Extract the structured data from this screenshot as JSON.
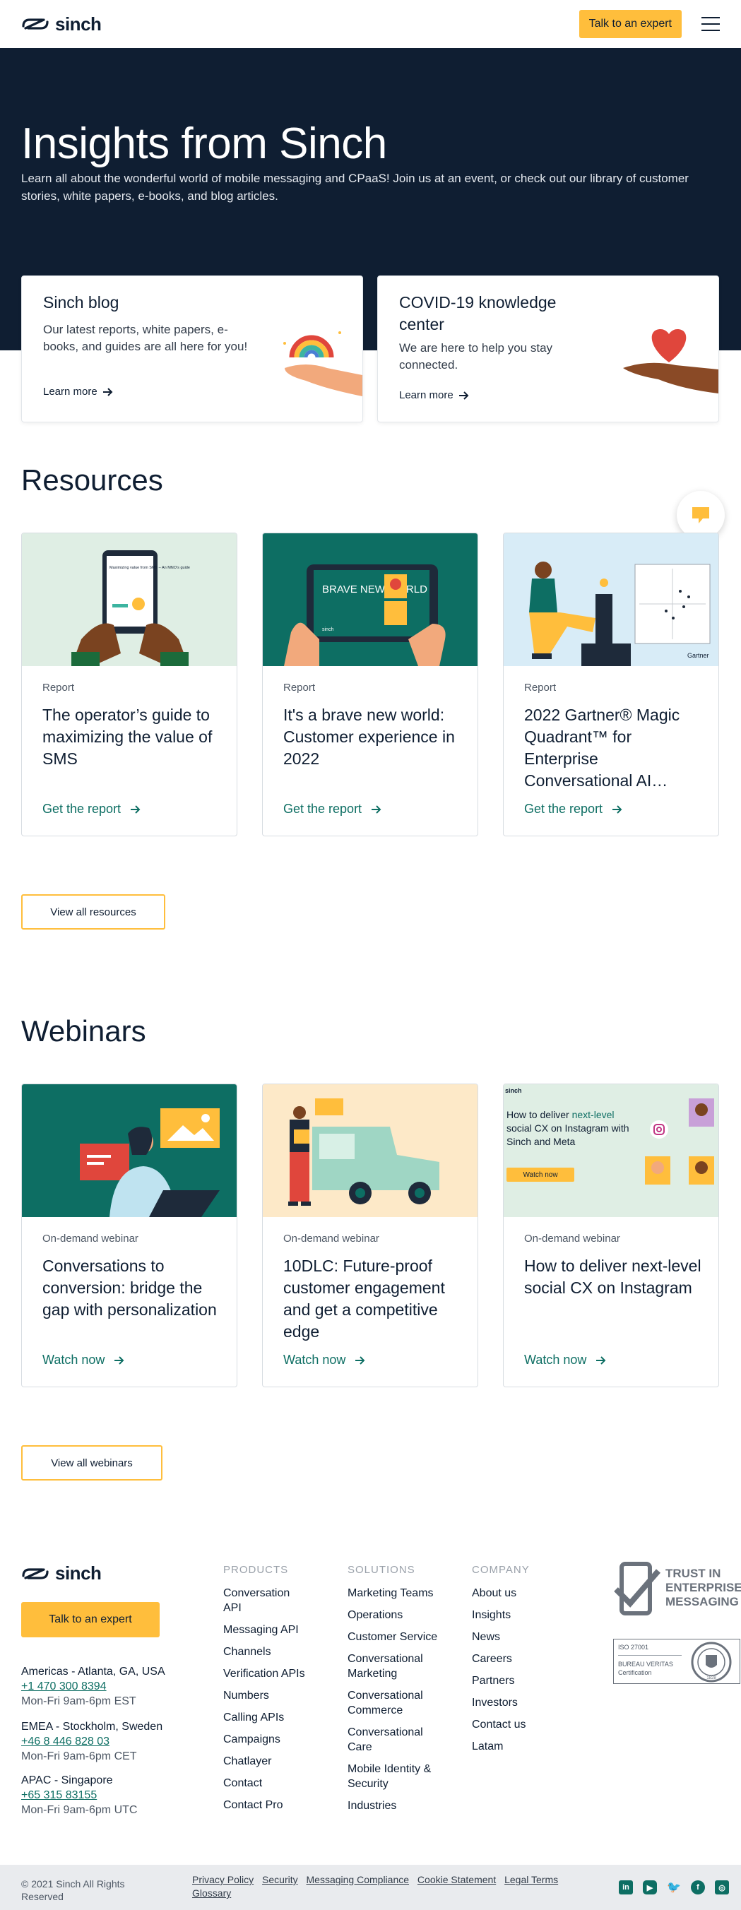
{
  "header": {
    "logo_text": "sinch",
    "cta_label": "Talk to an expert"
  },
  "hero": {
    "title": "Insights from Sinch",
    "subtitle": "Learn all about the wonderful world of mobile messaging and CPaaS! Join us at an event, or check out our library of customer stories, white papers, e-books, and blog articles."
  },
  "top_cards": [
    {
      "title": "Sinch blog",
      "text": "Our latest reports, white papers, e-books, and guides are all here for you!",
      "link": "Learn more"
    },
    {
      "title": "COVID-19 knowledge center",
      "text": "We are here to help you stay connected.",
      "link": "Learn more"
    }
  ],
  "resources": {
    "title": "Resources",
    "cards": [
      {
        "type": "Report",
        "title": "The operator’s guide to maximizing the value of SMS",
        "cta": "Get the report",
        "img_text": "Maximizing value from SMS – An MNO’s guide"
      },
      {
        "type": "Report",
        "title": "It's a brave new world: Customer experience in 2022",
        "cta": "Get the report",
        "img_text": "BRAVE NEW WORLD",
        "img_brand": "sinch"
      },
      {
        "type": "Report",
        "title": "2022 Gartner® Magic Quadrant™ for Enterprise Conversational AI…",
        "cta": "Get the report",
        "img_text": "Gartner"
      }
    ],
    "view_all": "View all resources"
  },
  "webinars": {
    "title": "Webinars",
    "cards": [
      {
        "type": "On-demand webinar",
        "title": "Conversations to conversion: bridge the gap with personalization",
        "cta": "Watch now"
      },
      {
        "type": "On-demand webinar",
        "title": "10DLC: Future-proof customer engagement and get a competitive edge",
        "cta": "Watch now"
      },
      {
        "type": "On-demand webinar",
        "title": "How to deliver next-level social CX on Instagram",
        "cta": "Watch now",
        "img_brand": "sinch",
        "img_title_a": "How to deliver ",
        "img_title_b": "next-level",
        "img_title_c": " social CX on Instagram with Sinch and Meta",
        "img_button": "Watch now"
      }
    ],
    "view_all": "View all webinars"
  },
  "footer": {
    "logo_text": "sinch",
    "cta_label": "Talk to an expert",
    "offices": [
      {
        "region": "Americas - Atlanta, GA, USA",
        "phone": "+1 470 300 8394",
        "hours": "Mon-Fri 9am-6pm EST"
      },
      {
        "region": "EMEA - Stockholm, Sweden",
        "phone": "+46 8 446 828 03",
        "hours": "Mon-Fri 9am-6pm CET"
      },
      {
        "region": "APAC - Singapore",
        "phone": "+65 315 83155",
        "hours": "Mon-Fri 9am-6pm UTC"
      }
    ],
    "columns": [
      {
        "heading": "PRODUCTS",
        "items": [
          "Conversation API",
          "Messaging API",
          "Channels",
          "Verification APIs",
          "Numbers",
          "Calling APIs",
          "Campaigns",
          "Chatlayer",
          "Contact",
          "Contact Pro"
        ]
      },
      {
        "heading": "SOLUTIONS",
        "items": [
          "Marketing Teams",
          "Operations",
          "Customer Service",
          "Conversational Marketing",
          "Conversational Commerce",
          "Conversational Care",
          "Mobile Identity & Security",
          "Industries"
        ]
      },
      {
        "heading": "COMPANY",
        "items": [
          "About us",
          "Insights",
          "News",
          "Careers",
          "Partners",
          "Investors",
          "Contact us",
          "Latam"
        ]
      }
    ],
    "trust_text": "TRUST IN ENTERPRISE MESSAGING",
    "iso_text": "ISO 27001",
    "bv_text": "BUREAU VERITAS",
    "bv_cert": "Certification",
    "bv_year": "1828"
  },
  "bottom_bar": {
    "copyright": "© 2021 Sinch All Rights Reserved",
    "links": [
      "Privacy Policy",
      "Security",
      "Messaging Compliance",
      "Cookie Statement",
      "Legal Terms",
      "Glossary"
    ],
    "social_icons": [
      "linkedin-icon",
      "youtube-icon",
      "twitter-icon",
      "facebook-icon",
      "instagram-icon"
    ]
  },
  "colors": {
    "navy": "#0f1e32",
    "yellow": "#ffbe3c",
    "teal": "#0d6e63"
  }
}
